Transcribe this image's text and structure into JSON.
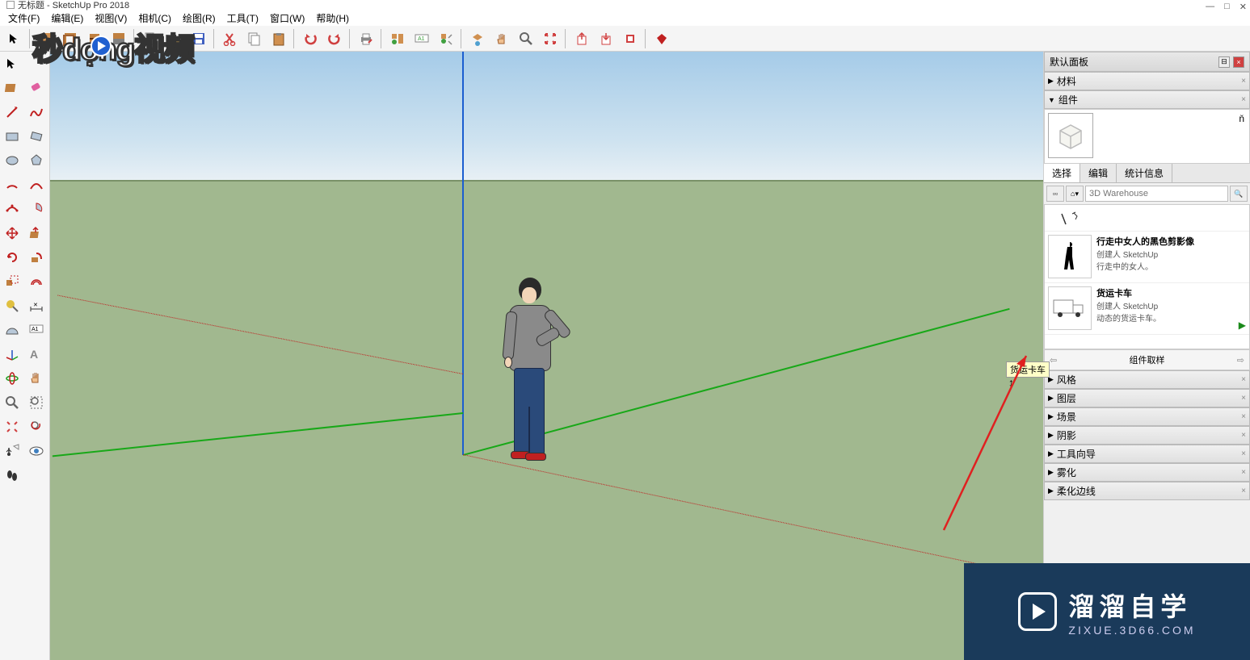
{
  "title": "无标题 - SketchUp Pro 2018",
  "menu": [
    "文件(F)",
    "编辑(E)",
    "视图(V)",
    "相机(C)",
    "绘图(R)",
    "工具(T)",
    "窗口(W)",
    "帮助(H)"
  ],
  "panel": {
    "title": "默认面板",
    "materials": "材料",
    "components": "组件",
    "tabs": [
      "选择",
      "编辑",
      "统计信息"
    ],
    "search_placeholder": "3D Warehouse",
    "items": [
      {
        "name": "",
        "line1": "",
        "line2": ""
      },
      {
        "name": "行走中女人的黑色剪影像",
        "line1": "创建人 SketchUp",
        "line2": "行走中的女人。"
      },
      {
        "name": "货运卡车",
        "line1": "创建人 SketchUp",
        "line2": "动态的货运卡车。"
      }
    ],
    "tooltip": "货运卡车",
    "sampling": "组件取样",
    "sections": [
      "风格",
      "图层",
      "场景",
      "阴影",
      "工具向导",
      "雾化",
      "柔化边线"
    ]
  },
  "watermark_top": "秒dọng视频",
  "watermark_br": {
    "main": "溜溜自学",
    "sub": "ZIXUE.3D66.COM"
  }
}
